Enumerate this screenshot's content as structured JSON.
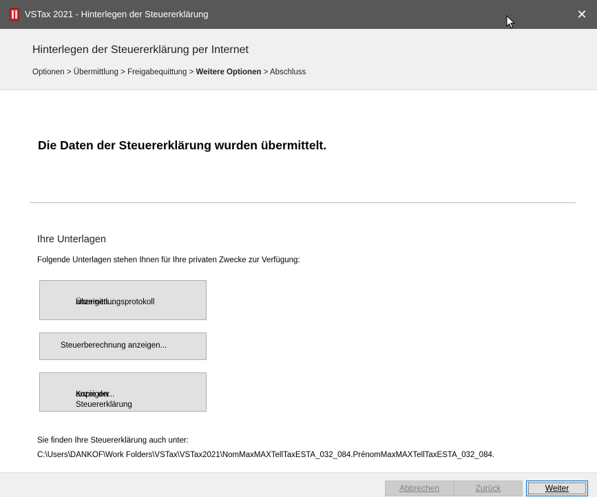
{
  "window": {
    "title": "VSTax 2021 - Hinterlegen der Steuererklärung",
    "close_glyph": "✕"
  },
  "header": {
    "title": "Hinterlegen der Steuererklärung per Internet",
    "breadcrumb": {
      "before": "Optionen > Übermittlung > Freigabequittung > ",
      "current": "Weitere Optionen",
      "after": " > Abschluss"
    }
  },
  "main": {
    "headline": "Die Daten der Steuererklärung wurden übermittelt.",
    "documents": {
      "title": "Ihre Unterlagen",
      "description": "Folgende Unterlagen stehen Ihnen für Ihre privaten Zwecke zur Verfügung:",
      "buttons": [
        {
          "line1": "Übermittlungsprotokoll",
          "line2": "anzeigen..."
        },
        {
          "label": "Steuerberechnung anzeigen..."
        },
        {
          "line1": "Kopie der Steuererklärung",
          "line2": "anzeigen..."
        }
      ]
    },
    "path_label": "Sie finden Ihre Steuererklärung auch unter:",
    "path_value": "C:\\Users\\DANKOF\\Work Folders\\VSTax\\VSTax2021\\NomMaxMAXTellTaxESTA_032_084.PrénomMaxMAXTellTaxESTA_032_084."
  },
  "footer": {
    "cancel_label": "Abbrechen",
    "back_label": "Zurück",
    "next_label": "Weiter"
  },
  "icons": {
    "app_icon": "vstax-app-icon",
    "cursor": "mouse-pointer-icon"
  },
  "colors": {
    "titlebar": "#585858",
    "accent_border": "#0078d7",
    "app_icon": "#c8282d"
  }
}
